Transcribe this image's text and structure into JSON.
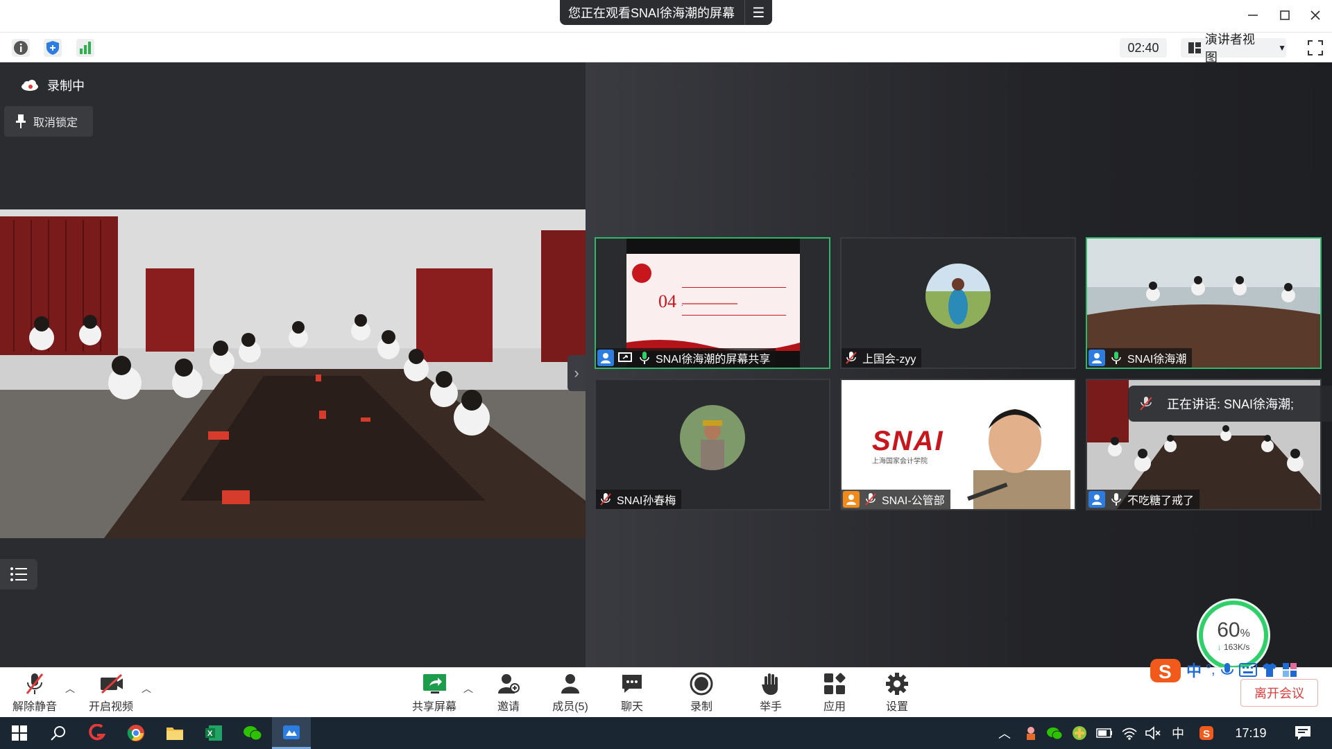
{
  "titlebar": {
    "screen_title": "您正在观看SNAI徐海潮的屏幕"
  },
  "toolbar": {
    "timer": "02:40",
    "view_mode": "演讲者视图"
  },
  "left": {
    "recording_label": "录制中",
    "unlock_label": "取消锁定"
  },
  "tiles": [
    {
      "name": "SNAI徐海潮的屏幕共享",
      "slide_number": "04",
      "active": true
    },
    {
      "name": "上国会-zyy",
      "active": false
    },
    {
      "name": "SNAI徐海潮",
      "active": true
    },
    {
      "name": "SNAI孙春梅",
      "active": false
    },
    {
      "name": "SNAI-公管部",
      "logo_text": "SNAI",
      "logo_sub": "上海国家会计学院",
      "active": false
    },
    {
      "name": "不吃糖了戒了",
      "active": false
    }
  ],
  "speaking": "正在讲话: SNAI徐海潮;",
  "network": {
    "percent": "60",
    "percent_unit": "%",
    "speed": "163K/s"
  },
  "bottom": {
    "unmute": "解除静音",
    "start_video": "开启视频",
    "share_screen": "共享屏幕",
    "invite": "邀请",
    "members": "成员(5)",
    "chat": "聊天",
    "record": "录制",
    "raise_hand": "举手",
    "apps": "应用",
    "settings": "设置",
    "leave": "离开会议"
  },
  "ime": {
    "lang": "中"
  },
  "taskbar": {
    "lang": "中",
    "time": "17:19"
  },
  "colors": {
    "accent_green": "#2fb86a",
    "leave_red": "#e33a3a",
    "taskbar_bg": "#1b2633"
  }
}
